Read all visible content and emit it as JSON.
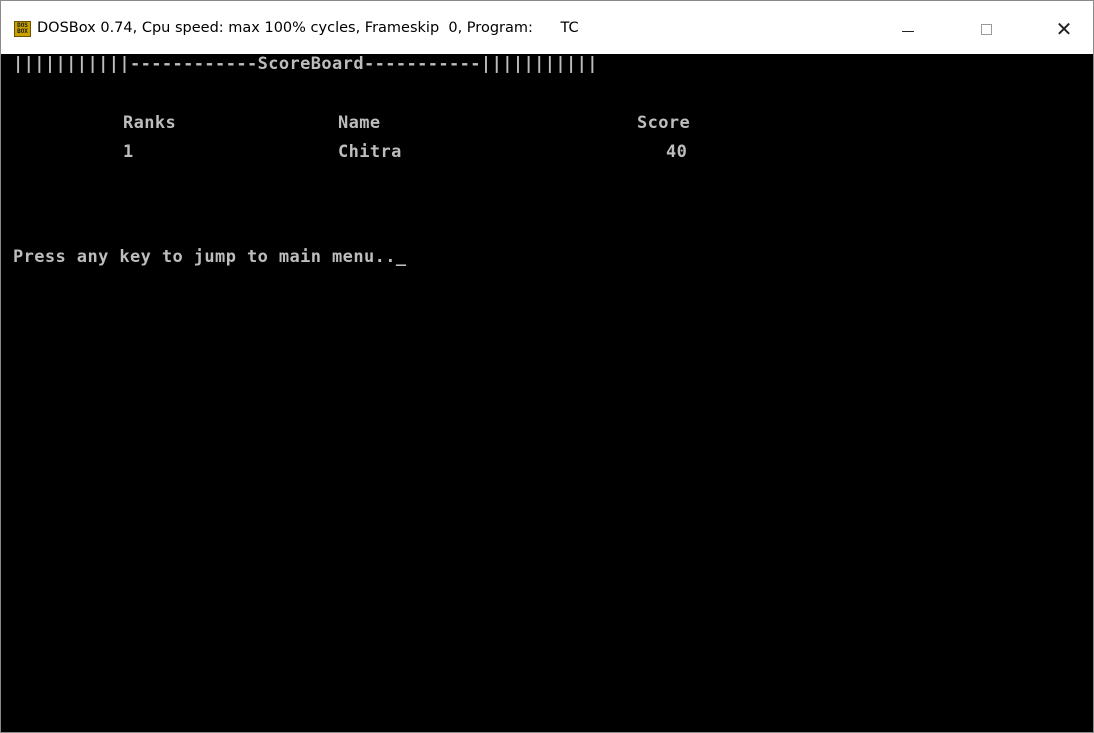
{
  "window": {
    "title": "DOSBox 0.74, Cpu speed: max 100% cycles, Frameskip  0, Program:      TC",
    "icon_text_top": "DOS",
    "icon_text_bottom": "BOX",
    "controls": {
      "minimize": "—",
      "maximize": "☐",
      "close": "✕"
    }
  },
  "screen": {
    "header_line": "|||||||||||------------ScoreBoard-----------|||||||||||",
    "columns": {
      "rank": "Ranks",
      "name": "Name",
      "score": "Score"
    },
    "rows": [
      {
        "rank": "1",
        "name": "Chitra",
        "score": "40"
      }
    ],
    "prompt": "Press any key to jump to main menu..",
    "cursor": "_"
  },
  "colors": {
    "screen_bg": "#000000",
    "text": "#bdbdbd",
    "titlebar_bg": "#ffffff"
  }
}
